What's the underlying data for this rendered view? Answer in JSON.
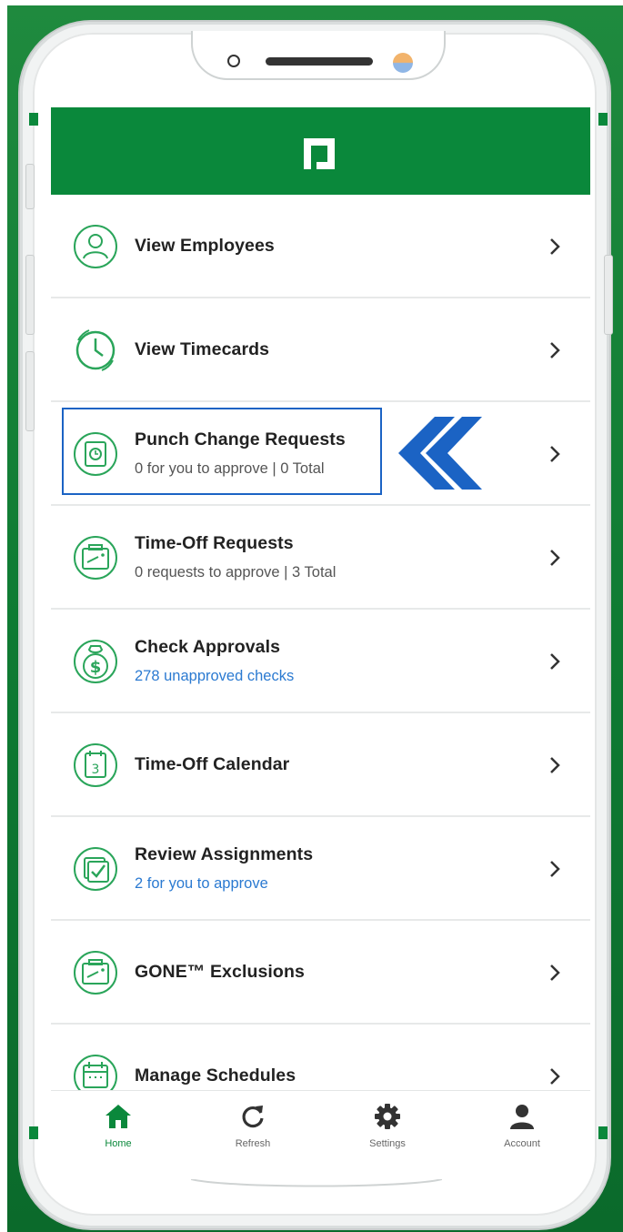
{
  "colors": {
    "brand_green": "#0a883b",
    "link_blue": "#2b7ad1",
    "highlight_blue": "#1b63c4"
  },
  "menu": [
    {
      "title": "View Employees",
      "subtitle": "",
      "icon": "employee-icon"
    },
    {
      "title": "View Timecards",
      "subtitle": "",
      "icon": "timecard-clock-icon"
    },
    {
      "title": "Punch Change Requests",
      "subtitle": "0 for you to approve | 0 Total",
      "icon": "punch-change-icon"
    },
    {
      "title": "Time-Off Requests",
      "subtitle": "0 requests to approve | 3 Total",
      "icon": "time-off-ticket-icon"
    },
    {
      "title": "Check Approvals",
      "subtitle": "278 unapproved checks",
      "icon": "money-bag-icon"
    },
    {
      "title": "Time-Off Calendar",
      "subtitle": "",
      "icon": "calendar-icon"
    },
    {
      "title": "Review Assignments",
      "subtitle": "2 for you to approve",
      "icon": "checklist-icon"
    },
    {
      "title": "GONE™ Exclusions",
      "subtitle": "",
      "icon": "exclusion-ticket-icon"
    },
    {
      "title": "Manage Schedules",
      "subtitle": "",
      "icon": "schedule-icon"
    }
  ],
  "tabs": [
    {
      "label": "Home",
      "icon": "home-icon",
      "active": true
    },
    {
      "label": "Refresh",
      "icon": "refresh-icon",
      "active": false
    },
    {
      "label": "Settings",
      "icon": "gear-icon",
      "active": false
    },
    {
      "label": "Account",
      "icon": "person-icon",
      "active": false
    }
  ]
}
